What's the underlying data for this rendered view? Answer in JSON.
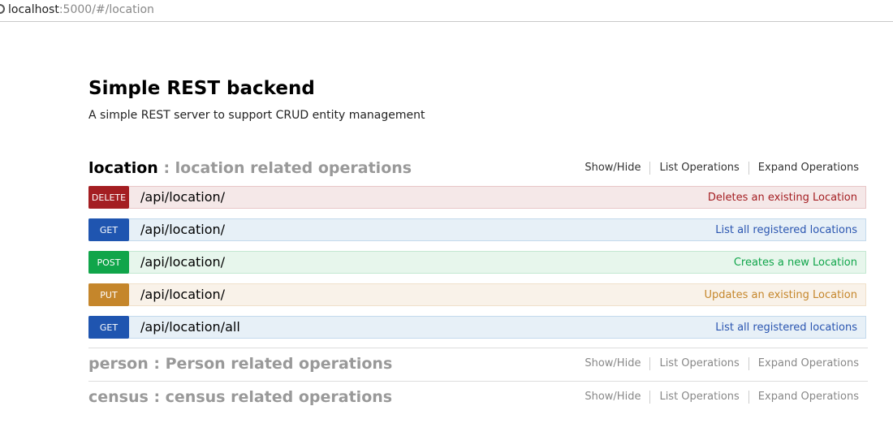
{
  "browser": {
    "url_host": "localhost",
    "url_path": ":5000/#/location"
  },
  "api": {
    "title": "Simple REST backend",
    "description": "A simple REST server to support CRUD entity management"
  },
  "actions": {
    "show_hide": "Show/Hide",
    "list_ops": "List Operations",
    "expand_ops": "Expand Operations"
  },
  "resources": [
    {
      "name": "location",
      "separator": " : ",
      "description": "location related operations",
      "operations": [
        {
          "method": "DELETE",
          "path": "/api/location/",
          "summary": "Deletes an existing Location"
        },
        {
          "method": "GET",
          "path": "/api/location/",
          "summary": "List all registered locations"
        },
        {
          "method": "POST",
          "path": "/api/location/",
          "summary": "Creates a new Location"
        },
        {
          "method": "PUT",
          "path": "/api/location/",
          "summary": "Updates an existing Location"
        },
        {
          "method": "GET",
          "path": "/api/location/all",
          "summary": "List all registered locations"
        }
      ]
    },
    {
      "name": "person",
      "separator": " : ",
      "description": "Person related operations"
    },
    {
      "name": "census",
      "separator": " : ",
      "description": "census related operations"
    }
  ]
}
